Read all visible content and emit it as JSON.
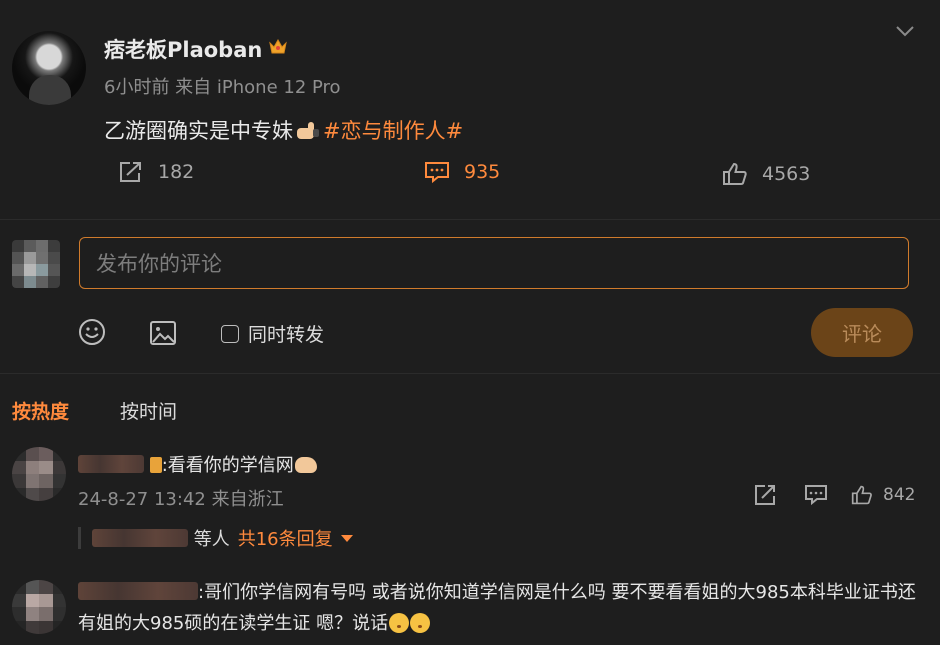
{
  "post": {
    "username": "痞老板Plaoban",
    "meta": "6小时前 来自 iPhone 12 Pro",
    "text": "乙游圈确实是中专妹",
    "hashtag": "#恋与制作人#",
    "actions": {
      "repost_count": "182",
      "comment_count": "935",
      "like_count": "4563"
    }
  },
  "composer": {
    "placeholder": "发布你的评论",
    "repost_label": "同时转发",
    "submit_label": "评论"
  },
  "sort_tabs": {
    "hot": "按热度",
    "time": "按时间"
  },
  "comments": [
    {
      "text": ":看看你的学信网",
      "meta": "24-8-27 13:42 来自浙江",
      "like_count": "842",
      "reply_prefix": "等人",
      "reply_more": "共16条回复"
    },
    {
      "text": ":哥们你学信网有号吗  或者说你知道学信网是什么吗  要不要看看姐的大985本科毕业证书还有姐的大985硕的在读学生证  嗯？说话"
    }
  ],
  "colors": {
    "accent": "#ff8a3d",
    "background": "#1e1e1e",
    "submit_bg": "#6b4418"
  }
}
